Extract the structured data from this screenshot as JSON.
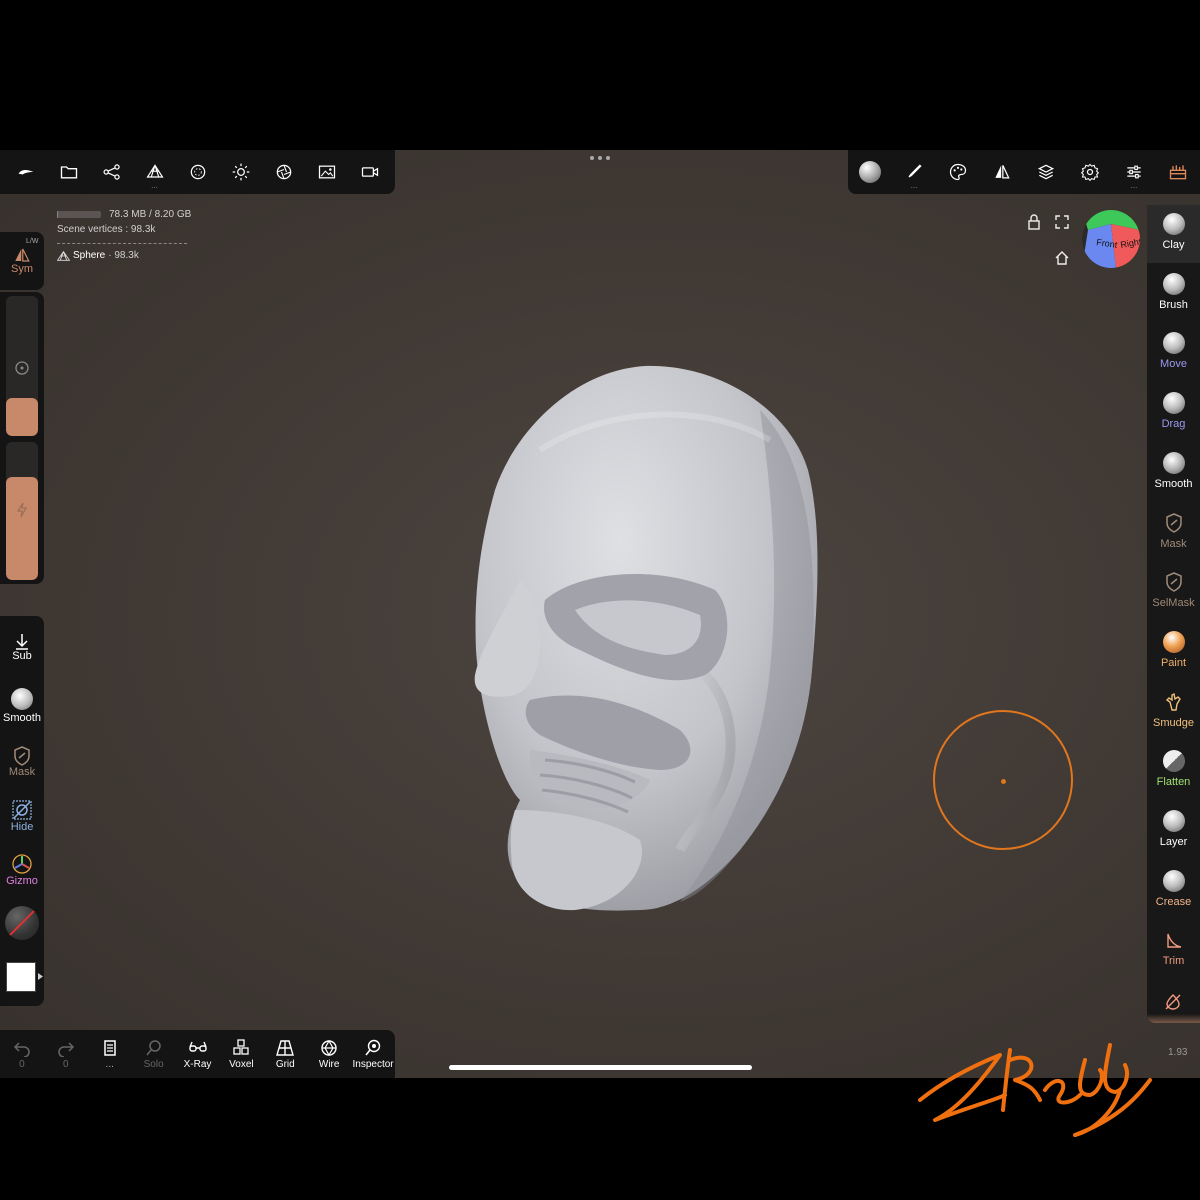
{
  "stats": {
    "memory": "78.3 MB / 8.20 GB",
    "memory_fraction": 0.01,
    "scene_vertices": "Scene vertices : 98.3k",
    "object_name": "Sphere",
    "object_vertices": "· 98.3k"
  },
  "top_left_toolbar": {
    "items": [
      "logo-icon",
      "folder-icon",
      "scene-graph-icon",
      "topology-icon",
      "material-icon",
      "light-icon",
      "camera-aperture-icon",
      "image-icon",
      "video-icon"
    ],
    "topology_sub": "..."
  },
  "top_right_toolbar": {
    "items": [
      "material-sphere-icon",
      "brush-stroke-icon",
      "palette-icon",
      "symmetry-icon",
      "layers-icon",
      "settings-icon",
      "sliders-icon",
      "toolbox-icon"
    ],
    "stroke_sub": "...",
    "sliders_sub": "..."
  },
  "view_cube": {
    "front": "Front",
    "right": "Right"
  },
  "left_panel": {
    "sym_label": "Sym",
    "sym_sub": "L/W",
    "radius_fraction": 0.27,
    "intensity_fraction": 0.75,
    "sub_label": "Sub",
    "smooth_label": "Smooth",
    "mask_label": "Mask",
    "hide_label": "Hide",
    "gizmo_label": "Gizmo"
  },
  "right_tools": [
    {
      "label": "Clay",
      "color": "#ffffff"
    },
    {
      "label": "Brush",
      "color": "#ffffff"
    },
    {
      "label": "Move",
      "color": "#9a9af0"
    },
    {
      "label": "Drag",
      "color": "#9a9af0"
    },
    {
      "label": "Smooth",
      "color": "#ffffff"
    },
    {
      "label": "Mask",
      "color": "#a08a78"
    },
    {
      "label": "SelMask",
      "color": "#a08a78"
    },
    {
      "label": "Paint",
      "color": "#f0b06a"
    },
    {
      "label": "Smudge",
      "color": "#f0c07a"
    },
    {
      "label": "Flatten",
      "color": "#a0e070"
    },
    {
      "label": "Layer",
      "color": "#ffffff"
    },
    {
      "label": "Crease",
      "color": "#f0b48a"
    },
    {
      "label": "Trim",
      "color": "#f09a80"
    }
  ],
  "bottom_toolbar": {
    "undo_count": "0",
    "redo_count": "0",
    "history_sub": "...",
    "solo": "Solo",
    "xray": "X-Ray",
    "voxel": "Voxel",
    "grid": "Grid",
    "wire": "Wire",
    "inspector": "Inspector"
  },
  "zoom": "1.93",
  "colors": {
    "accent": "#e0761e",
    "panel": "#141414",
    "viewport": "#403934",
    "model": "#cfd0d4"
  }
}
